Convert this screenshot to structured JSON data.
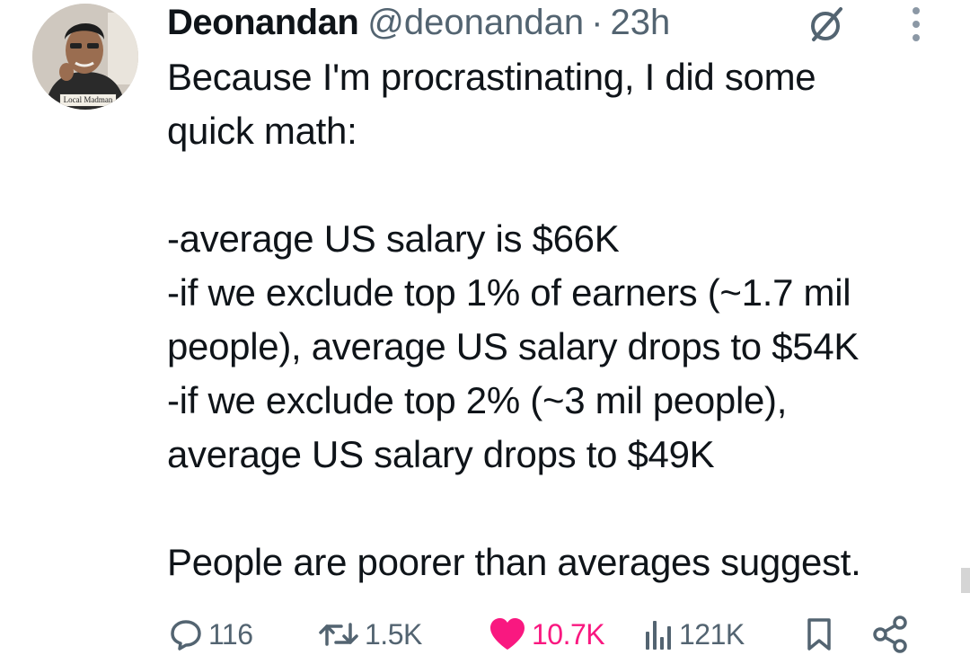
{
  "post": {
    "avatar_caption": "Local Madman",
    "display_name": "Deonandan",
    "handle": "@deonandan",
    "separator": "·",
    "time": "23h",
    "lines": [
      "Because I'm procrastinating, I did some",
      "quick math:",
      "",
      "-average US salary is $66K",
      "-if we exclude top 1% of earners (~1.7 mil",
      "people), average US salary drops to $54K",
      "-if we exclude top 2% (~3 mil people),",
      "average US salary drops to $49K",
      "",
      "People are poorer than averages suggest."
    ]
  },
  "actions": {
    "replies": "116",
    "reposts": "1.5K",
    "likes": "10.7K",
    "views": "121K"
  },
  "icons": {
    "reply": "reply-icon",
    "repost": "retweet-icon",
    "like": "heart-icon",
    "views": "views-icon",
    "bookmark": "bookmark-icon",
    "share": "share-icon",
    "grok": "grok-icon",
    "more": "more-icon"
  },
  "colors": {
    "text": "#0f1419",
    "muted": "#536471",
    "like": "#f91880"
  }
}
